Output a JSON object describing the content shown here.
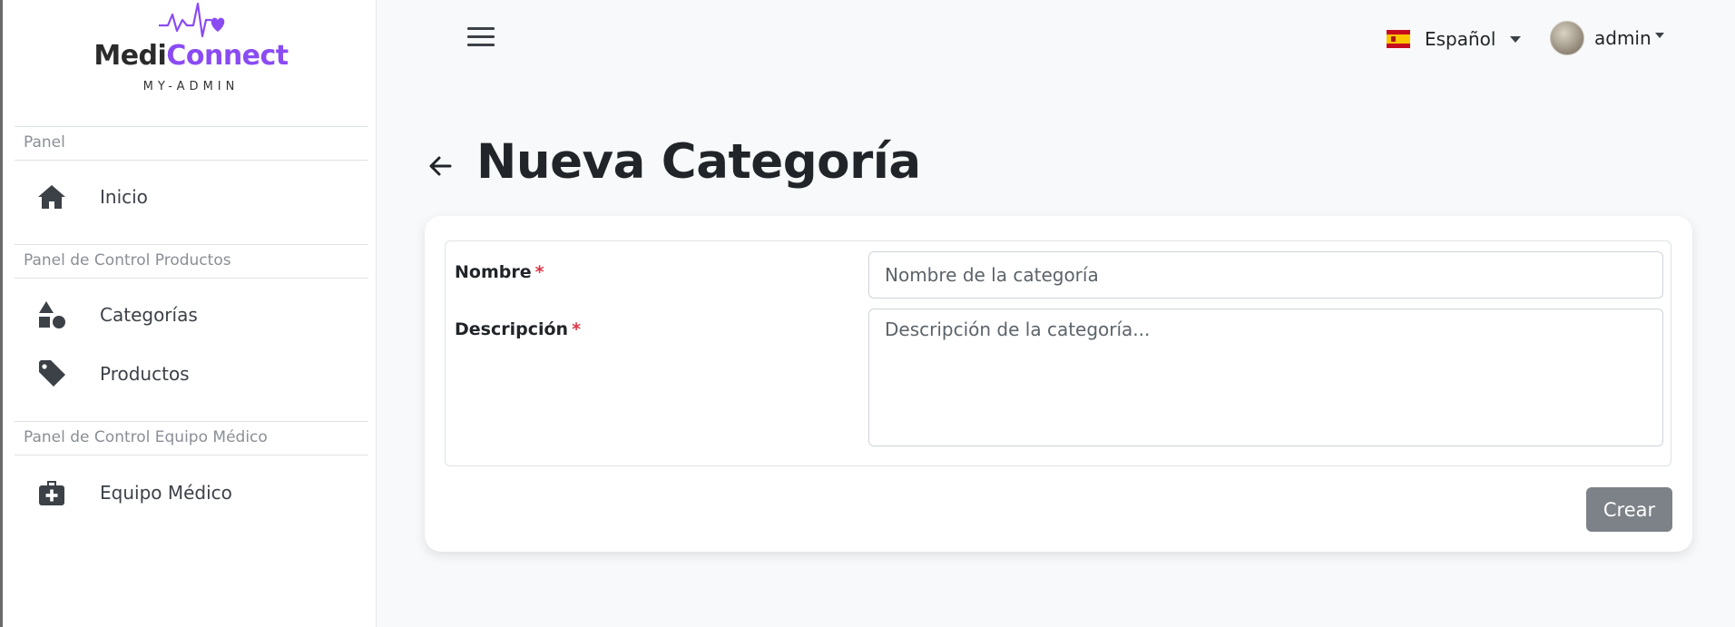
{
  "brand": {
    "name_part1": "Medi",
    "name_part2": "Connect",
    "subtitle": "MY-ADMIN",
    "accent_color": "#8a4bf3"
  },
  "sidebar": {
    "sections": [
      {
        "title": "Panel",
        "items": [
          {
            "label": "Inicio",
            "icon": "home-icon"
          }
        ]
      },
      {
        "title": "Panel de Control Productos",
        "items": [
          {
            "label": "Categorías",
            "icon": "shapes-icon"
          },
          {
            "label": "Productos",
            "icon": "tag-icon"
          }
        ]
      },
      {
        "title": "Panel de Control Equipo Médico",
        "items": [
          {
            "label": "Equipo Médico",
            "icon": "medkit-icon"
          }
        ]
      }
    ]
  },
  "topbar": {
    "language": "Español",
    "language_flag": "spain-flag-icon",
    "user": "admin"
  },
  "page": {
    "title": "Nueva Categoría"
  },
  "form": {
    "name_label": "Nombre",
    "name_placeholder": "Nombre de la categoría",
    "name_value": "",
    "description_label": "Descripción",
    "description_placeholder": "Descripción de la categoría...",
    "description_value": "",
    "required_mark": "*",
    "submit_label": "Crear"
  }
}
